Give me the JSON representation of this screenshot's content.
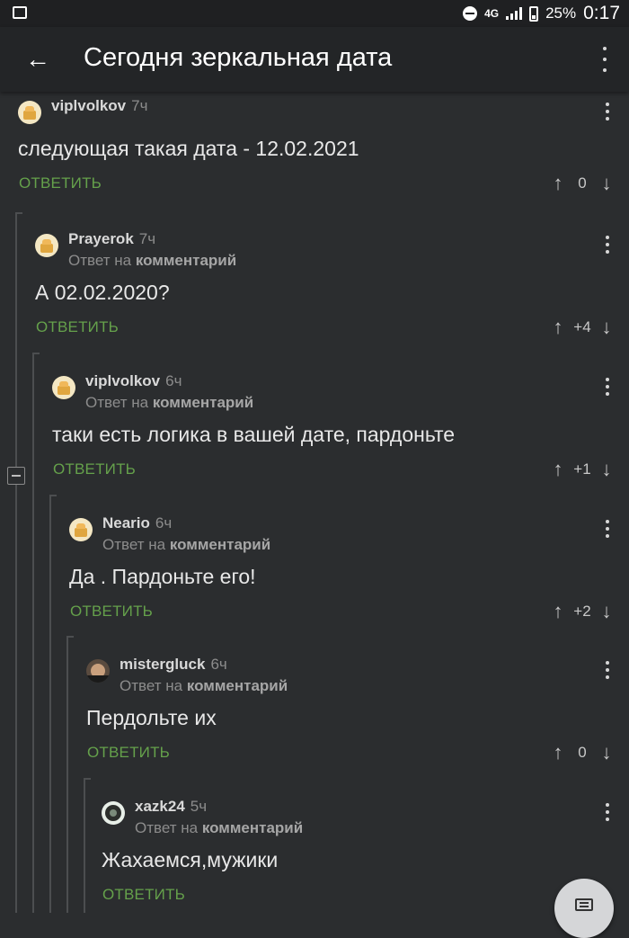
{
  "status_bar": {
    "network": "4G",
    "battery": "25%",
    "time": "0:17"
  },
  "app_bar": {
    "title": "Сегодня зеркальная дата"
  },
  "labels": {
    "reply_to_prefix": "Ответ на",
    "reply_to_target": "комментарий",
    "reply_action": "ОТВЕТИТЬ",
    "upvote": "↑",
    "downvote": "↓"
  },
  "comments": [
    {
      "author": "viplvolkov",
      "time": "7ч",
      "text": "следующая такая дата - 12.02.2021",
      "votes": "0",
      "is_reply": false
    },
    {
      "author": "Prayerok",
      "time": "7ч",
      "text": "А 02.02.2020?",
      "votes": "+4",
      "is_reply": true
    },
    {
      "author": "viplvolkov",
      "time": "6ч",
      "text": "таки есть логика в вашей дате, пардоньте",
      "votes": "+1",
      "is_reply": true
    },
    {
      "author": "Neario",
      "time": "6ч",
      "text": "Да . Пардоньте его!",
      "votes": "+2",
      "is_reply": true
    },
    {
      "author": "mistergluck",
      "time": "6ч",
      "text": "Пердольте их",
      "votes": "0",
      "is_reply": true
    },
    {
      "author": "xazk24",
      "time": "5ч",
      "text": "Жахаемся,мужики",
      "votes": "",
      "is_reply": true
    }
  ]
}
